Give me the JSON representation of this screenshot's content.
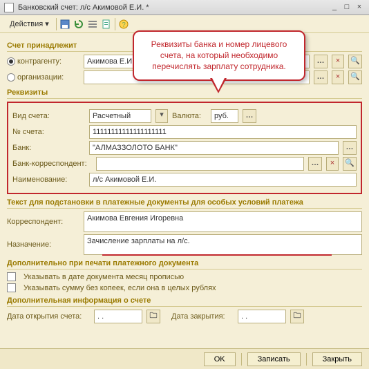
{
  "window": {
    "title": "Банковский счет: л/с Акимовой Е.И. *"
  },
  "toolbar": {
    "actions": "Действия"
  },
  "callout": {
    "text": "Реквизиты банка и номер лицевого счета, на который необходимо перечислять зарплату сотрудника."
  },
  "section_owner": {
    "title": "Счет принадлежит",
    "radio_contragent": "контрагенту:",
    "contragent_value": "Акимова Е.И.",
    "radio_org": "организации:",
    "org_value": ""
  },
  "section_requisites": {
    "title": "Реквизиты",
    "account_type_label": "Вид счета:",
    "account_type_value": "Расчетный",
    "currency_label": "Валюта:",
    "currency_value": "руб.",
    "account_no_label": "№ счета:",
    "account_no_value": "11111111111111111111",
    "bank_label": "Банк:",
    "bank_value": "\"АЛМАЗЗОЛОТО БАНК\"",
    "corr_bank_label": "Банк-корреспондент:",
    "corr_bank_value": "",
    "name_label": "Наименование:",
    "name_value": "л/с Акимовой Е.И."
  },
  "section_subst": {
    "title": "Текст для подстановки в платежные документы для особых условий платежа",
    "corr_label": "Корреспондент:",
    "corr_value": "Акимова Евгения Игоревна",
    "purpose_label": "Назначение:",
    "purpose_value": "Зачисление зарплаты на л/с."
  },
  "section_extra": {
    "title": "Дополнительно при печати платежного документа",
    "chk1": "Указывать в дате документа месяц прописью",
    "chk2": "Указывать сумму без копеек, если она в целых рублях"
  },
  "section_info": {
    "title": "Дополнительная информация о счете",
    "open_label": "Дата открытия счета:",
    "open_value": "  .  .",
    "close_label": "Дата закрытия:",
    "close_value": "  .  ."
  },
  "footer": {
    "ok": "OK",
    "save": "Записать",
    "close": "Закрыть"
  }
}
